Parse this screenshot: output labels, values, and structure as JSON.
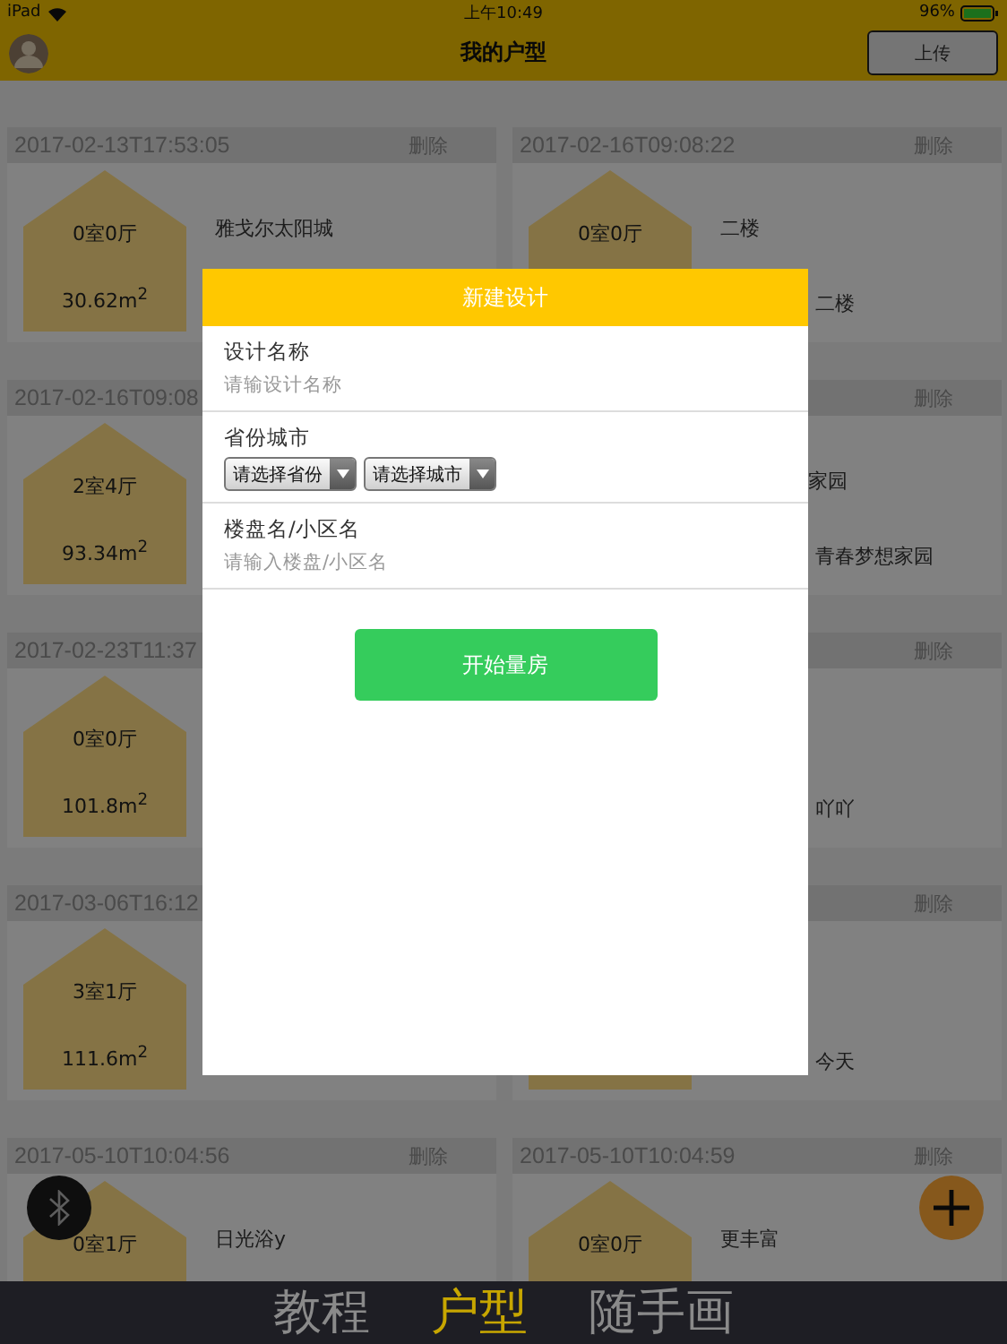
{
  "status_bar": {
    "device": "iPad",
    "time": "上午10:49",
    "battery": "96%"
  },
  "nav": {
    "title": "我的户型",
    "upload": "上传"
  },
  "cards": [
    {
      "date": "2017-02-13T17:53:05",
      "delete": "删除",
      "rooms": "0室0厅",
      "area": "30.62m$^{2}$",
      "name": "雅戈尔太阳城"
    },
    {
      "date": "2017-02-16T09:08:22",
      "delete": "删除",
      "rooms": "0室0厅",
      "district": "二楼",
      "name": "二楼"
    },
    {
      "date": "2017-02-16T09:08",
      "rooms": "2室4厅",
      "area": "93.34m$^{2}$"
    },
    {
      "delete": "删除",
      "name": "家园",
      "name_cut": true,
      "district": "青春梦想家园"
    },
    {
      "date": "2017-02-23T11:37",
      "rooms": "0室0厅",
      "area": "101.8m$^{2}$"
    },
    {
      "delete": "删除",
      "district": "吖吖"
    },
    {
      "date": "2017-03-06T16:12",
      "rooms": "3室1厅",
      "area": "111.6m$^{2}$"
    },
    {
      "delete": "删除",
      "house": true,
      "district": "今天"
    },
    {
      "date": "2017-05-10T10:04:56",
      "delete": "删除",
      "rooms": "0室1厅",
      "name": "日光浴y"
    },
    {
      "date": "2017-05-10T10:04:59",
      "delete": "删除",
      "rooms": "0室0厅",
      "name": "更丰富"
    }
  ],
  "dialog": {
    "title": "新建设计",
    "fields": [
      {
        "kind": "text",
        "label": "设计名称",
        "placeholder": "请输设计名称"
      },
      {
        "kind": "selects",
        "label": "省份城市",
        "options": [
          "请选择省份",
          "请选择城市"
        ]
      },
      {
        "kind": "text",
        "label": "楼盘名/小区名",
        "placeholder": "请输入楼盘/小区名"
      }
    ],
    "button": "开始量房"
  },
  "tabs": [
    {
      "label": "教程",
      "selected": false
    },
    {
      "label": "户型",
      "selected": true
    },
    {
      "label": "随手画",
      "selected": false
    }
  ]
}
